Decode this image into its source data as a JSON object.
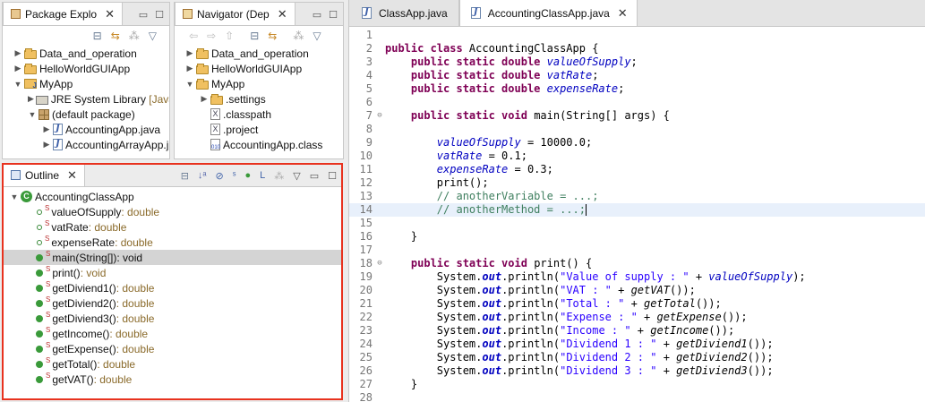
{
  "package_explorer": {
    "tab_label": "Package Explo",
    "items": [
      {
        "label": "Data_and_operation",
        "suffix": ""
      },
      {
        "label": "HelloWorldGUIApp",
        "suffix": ""
      },
      {
        "label": "MyApp",
        "suffix": ""
      },
      {
        "label": "JRE System Library",
        "suffix": "[Java"
      },
      {
        "label": "(default package)",
        "suffix": ""
      },
      {
        "label": "AccountingApp.java",
        "suffix": ""
      },
      {
        "label": "AccountingArrayApp.j",
        "suffix": ""
      }
    ]
  },
  "navigator": {
    "tab_label": "Navigator (Dep",
    "items": [
      {
        "label": "Data_and_operation"
      },
      {
        "label": "HelloWorldGUIApp"
      },
      {
        "label": "MyApp"
      },
      {
        "label": ".settings"
      },
      {
        "label": ".classpath"
      },
      {
        "label": ".project"
      },
      {
        "label": "AccountingApp.class"
      }
    ]
  },
  "outline": {
    "tab_label": "Outline",
    "class_name": "AccountingClassApp",
    "members": [
      {
        "name": "valueOfSupply",
        "type": " : double"
      },
      {
        "name": "vatRate",
        "type": " : double"
      },
      {
        "name": "expenseRate",
        "type": " : double"
      },
      {
        "name": "main(String[])",
        "type": " : void"
      },
      {
        "name": "print()",
        "type": " : void"
      },
      {
        "name": "getDiviend1()",
        "type": " : double"
      },
      {
        "name": "getDiviend2()",
        "type": " : double"
      },
      {
        "name": "getDiviend3()",
        "type": " : double"
      },
      {
        "name": "getIncome()",
        "type": " : double"
      },
      {
        "name": "getExpense()",
        "type": " : double"
      },
      {
        "name": "getTotal()",
        "type": " : double"
      },
      {
        "name": "getVAT()",
        "type": " : double"
      }
    ],
    "static_marker": "S"
  },
  "editor": {
    "tabs": [
      {
        "label": "ClassApp.java"
      },
      {
        "label": "AccountingClassApp.java"
      }
    ],
    "line_numbers": [
      "1",
      "2",
      "3",
      "4",
      "5",
      "6",
      "7",
      "8",
      "9",
      "10",
      "11",
      "12",
      "13",
      "14",
      "15",
      "16",
      "17",
      "18",
      "19",
      "20",
      "21",
      "22",
      "23",
      "24",
      "25",
      "26",
      "27",
      "28"
    ],
    "code": {
      "l2_kw": "public class ",
      "l2_rest": "AccountingClassApp {",
      "l3_kw": "public static double ",
      "l3_f": "valueOfSupply",
      "l3_end": ";",
      "l4_kw": "public static double ",
      "l4_f": "vatRate",
      "l4_end": ";",
      "l5_kw": "public static double ",
      "l5_f": "expenseRate",
      "l5_end": ";",
      "l7_kw": "public static void ",
      "l7_rest": "main(String[] args) {",
      "l9_f": "valueOfSupply",
      "l9_rest": " = 10000.0;",
      "l10_f": "vatRate",
      "l10_rest": " = 0.1;",
      "l11_f": "expenseRate",
      "l11_rest": " = 0.3;",
      "l12": "print();",
      "l13": "// anotherVariable = ...;",
      "l14": "// anotherMethod = ...;",
      "l16": "}",
      "l18_kw": "public static void ",
      "l18_rest": "print() {",
      "sys": "System.",
      "out": "out",
      "println": ".println(",
      "l19_s": "\"Value of supply : \"",
      "l19_plus": " + ",
      "l19_f": "valueOfSupply",
      "l19_end": ");",
      "l20_s": "\"VAT : \"",
      "l20_plus": " + ",
      "l20_m": "getVAT",
      "l20_end": "());",
      "l21_s": "\"Total : \"",
      "l21_plus": " + ",
      "l21_m": "getTotal",
      "l21_end": "());",
      "l22_s": "\"Expense : \"",
      "l22_plus": " + ",
      "l22_m": "getExpense",
      "l22_end": "());",
      "l23_s": "\"Income : \"",
      "l23_plus": " + ",
      "l23_m": "getIncome",
      "l23_end": "());",
      "l24_s": "\"Dividend 1 : \"",
      "l24_plus": " + ",
      "l24_m": "getDiviend1",
      "l24_end": "());",
      "l25_s": "\"Dividend 2 : \"",
      "l25_plus": " + ",
      "l25_m": "getDiviend2",
      "l25_end": "());",
      "l26_s": "\"Dividend 3 : \"",
      "l26_plus": " + ",
      "l26_m": "getDiviend3",
      "l26_end": "());",
      "l27": "}"
    }
  },
  "colors": {
    "highlight_border": "#e8321e",
    "keyword": "#7f0055",
    "field": "#0000c0",
    "string": "#2a00ff",
    "comment": "#3f7f5f"
  }
}
